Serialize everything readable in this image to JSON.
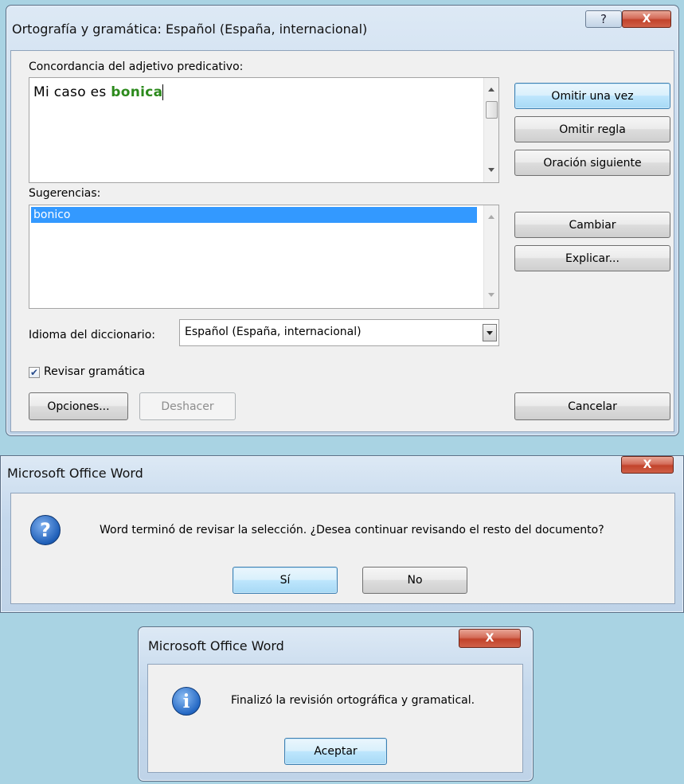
{
  "spelling_dialog": {
    "title": "Ortografía y gramática: Español (España, internacional)",
    "help_label": "?",
    "close_label": "X",
    "issue_label": "Concordancia del adjetivo predicativo:",
    "sentence_prefix": "Mi caso es ",
    "sentence_error": "bonica",
    "suggestions_label": "Sugerencias:",
    "suggestions": [
      "bonico"
    ],
    "dictionary_label": "Idioma del diccionario:",
    "dictionary_value": "Español (España, internacional)",
    "check_grammar_label": "Revisar gramática",
    "check_grammar_checked": true,
    "buttons": {
      "ignore_once": "Omitir una vez",
      "ignore_rule": "Omitir regla",
      "next_sentence": "Oración siguiente",
      "change": "Cambiar",
      "explain": "Explicar...",
      "options": "Opciones...",
      "undo": "Deshacer",
      "cancel": "Cancelar"
    }
  },
  "continue_dialog": {
    "title": "Microsoft Office Word",
    "close_label": "X",
    "icon_glyph": "?",
    "message": "Word terminó de revisar la selección. ¿Desea continuar revisando el resto del documento?",
    "yes_label": "Sí",
    "no_label": "No"
  },
  "finished_dialog": {
    "title": "Microsoft Office Word",
    "close_label": "X",
    "icon_glyph": "i",
    "message": "Finalizó la revisión ortográfica y gramatical.",
    "ok_label": "Aceptar"
  },
  "colors": {
    "error_word": "#2c8a1c",
    "selection": "#3399ff",
    "question_icon": "#1f5fb8",
    "info_icon": "#2468c4"
  }
}
